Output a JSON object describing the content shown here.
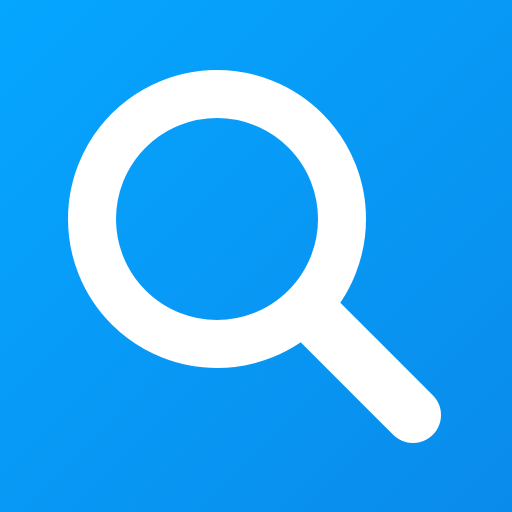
{
  "app_icon": {
    "icon": "search-icon",
    "colors": {
      "background_start": "#05A6FF",
      "background_end": "#0A8BEB",
      "glyph": "#FFFFFF"
    }
  }
}
